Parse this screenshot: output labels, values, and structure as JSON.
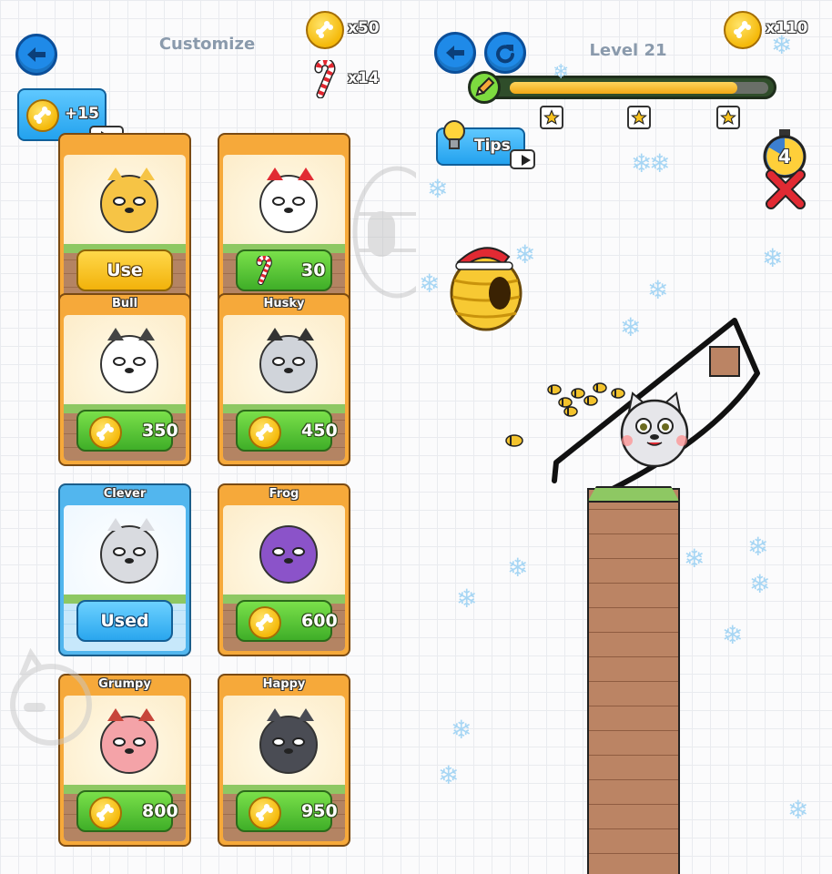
{
  "left": {
    "title": "Customize",
    "coins": "x50",
    "candy": "x14",
    "reward_button": "+15",
    "cards": [
      {
        "name": "",
        "price": "",
        "button": "Use",
        "state": "use",
        "avatar": "shiba-avatar-icon"
      },
      {
        "name": "",
        "price": "30",
        "button": "",
        "state": "candy",
        "avatar": "santa-avatar-icon"
      },
      {
        "name": "Bull",
        "price": "350",
        "button": "",
        "state": "buy",
        "avatar": "bull-dog-avatar-icon"
      },
      {
        "name": "Husky",
        "price": "450",
        "button": "",
        "state": "buy",
        "avatar": "husky-avatar-icon"
      },
      {
        "name": "Clever",
        "price": "",
        "button": "Used",
        "state": "used",
        "avatar": "clever-cat-avatar-icon"
      },
      {
        "name": "Frog",
        "price": "600",
        "button": "",
        "state": "buy",
        "avatar": "frog-avatar-icon"
      },
      {
        "name": "Grumpy",
        "price": "800",
        "button": "",
        "state": "buy",
        "avatar": "pig-avatar-icon"
      },
      {
        "name": "Happy",
        "price": "950",
        "button": "",
        "state": "buy",
        "avatar": "happy-cat-avatar-icon"
      }
    ]
  },
  "right": {
    "title": "Level  21",
    "coins": "x110",
    "tips_label": "Tips",
    "timer_value": "4",
    "ink_progress": 0.88,
    "stars": 3
  },
  "colors": {
    "blue": "#1f8ae8",
    "orange_card": "#f6a93a",
    "selected_card": "#52b6ee",
    "green_button": "#3fae28",
    "yellow_button": "#f2b20b",
    "title_gray": "#8a9aac"
  }
}
